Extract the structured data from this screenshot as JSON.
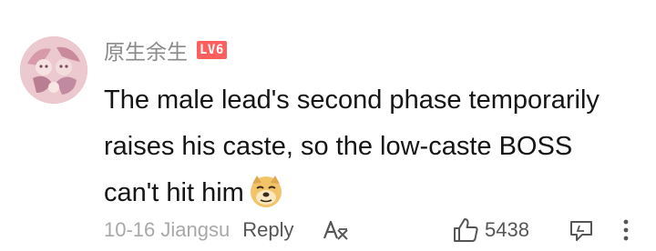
{
  "user": {
    "name": "原生余生",
    "level_badge": "LV6"
  },
  "comment": {
    "lines": [
      "The male lead's second phase temporarily",
      "raises his caste, so the low-caste BOSS",
      "can't hit him"
    ],
    "emoji": "doge-emoji"
  },
  "meta": {
    "date_location": "10-16 Jiangsu",
    "reply_label": "Reply",
    "like_count": "5438"
  },
  "icons": {
    "translate": "translate-icon",
    "like": "thumbs-up-icon",
    "dislike": "comment-dislike-icon",
    "more": "more-vertical-icon"
  },
  "colors": {
    "badge": "#ff5e5e",
    "text": "#151515",
    "muted": "#a8a8a8"
  }
}
